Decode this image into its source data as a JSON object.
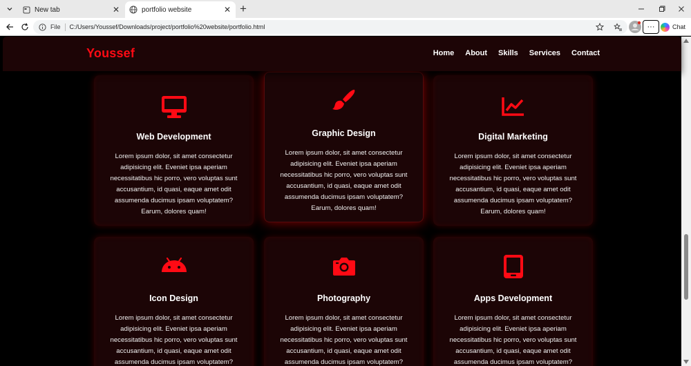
{
  "browser": {
    "tabs": [
      {
        "title": "New tab",
        "active": false
      },
      {
        "title": "portfolio website",
        "active": true
      }
    ],
    "address": {
      "scheme": "File",
      "url": "C:/Users/Youssef/Downloads/project/portfolio%20website/portfolio.html"
    },
    "chat_label": "Chat",
    "more_label": "···"
  },
  "site": {
    "logo": "Youssef",
    "nav": [
      "Home",
      "About",
      "Skills",
      "Services",
      "Contact"
    ],
    "accent_color": "#ff0a14"
  },
  "services": [
    {
      "title": "Web Development",
      "icon": "monitor-icon",
      "text": "Lorem ipsum dolor, sit amet consectetur adipisicing elit. Eveniet ipsa aperiam necessitatibus hic porro, vero voluptas sunt accusantium, id quasi, eaque amet odit assumenda ducimus ipsam voluptatem? Earum, dolores quam!"
    },
    {
      "title": "Graphic Design",
      "icon": "paintbrush-icon",
      "text": "Lorem ipsum dolor, sit amet consectetur adipisicing elit. Eveniet ipsa aperiam necessitatibus hic porro, vero voluptas sunt accusantium, id quasi, eaque amet odit assumenda ducimus ipsam voluptatem? Earum, dolores quam!"
    },
    {
      "title": "Digital Marketing",
      "icon": "line-chart-icon",
      "text": "Lorem ipsum dolor, sit amet consectetur adipisicing elit. Eveniet ipsa aperiam necessitatibus hic porro, vero voluptas sunt accusantium, id quasi, eaque amet odit assumenda ducimus ipsam voluptatem? Earum, dolores quam!"
    },
    {
      "title": "Icon Design",
      "icon": "android-icon",
      "text": "Lorem ipsum dolor, sit amet consectetur adipisicing elit. Eveniet ipsa aperiam necessitatibus hic porro, vero voluptas sunt accusantium, id quasi, eaque amet odit assumenda ducimus ipsam voluptatem?"
    },
    {
      "title": "Photography",
      "icon": "camera-icon",
      "text": "Lorem ipsum dolor, sit amet consectetur adipisicing elit. Eveniet ipsa aperiam necessitatibus hic porro, vero voluptas sunt accusantium, id quasi, eaque amet odit assumenda ducimus ipsam voluptatem?"
    },
    {
      "title": "Apps Development",
      "icon": "tablet-icon",
      "text": "Lorem ipsum dolor, sit amet consectetur adipisicing elit. Eveniet ipsa aperiam necessitatibus hic porro, vero voluptas sunt accusantium, id quasi, eaque amet odit assumenda ducimus ipsam voluptatem?"
    }
  ]
}
